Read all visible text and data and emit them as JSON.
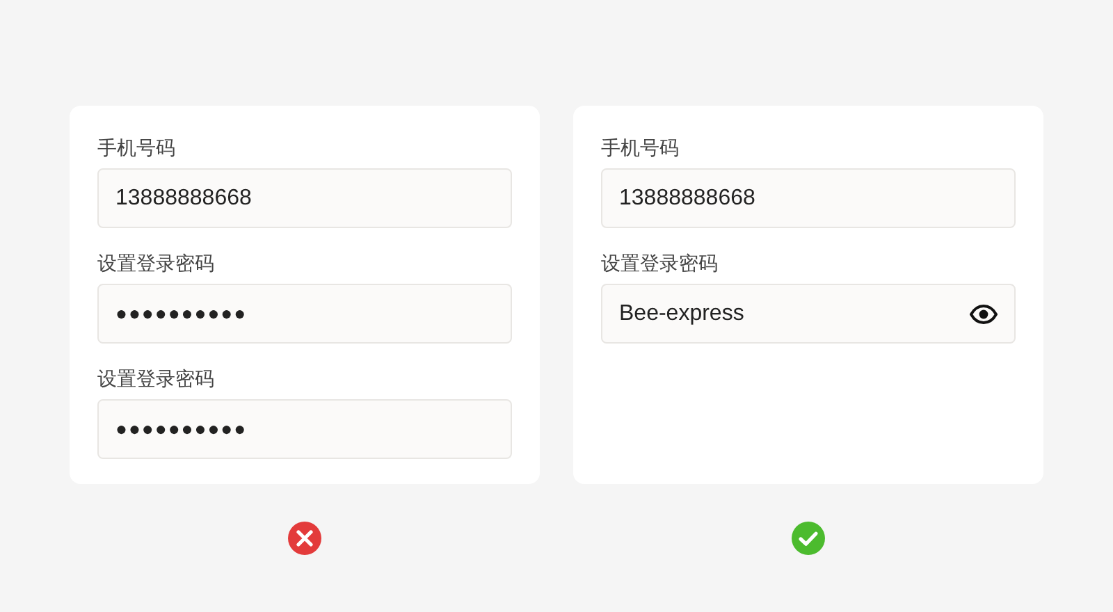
{
  "panels": [
    {
      "kind": "wrong",
      "fields": [
        {
          "label": "手机号码",
          "value": "13888888668",
          "kind": "text"
        },
        {
          "label": "设置登录密码",
          "value": "●●●●●●●●●●",
          "kind": "password"
        },
        {
          "label": "设置登录密码",
          "value": "●●●●●●●●●●",
          "kind": "password"
        }
      ]
    },
    {
      "kind": "right",
      "fields": [
        {
          "label": "手机号码",
          "value": "13888888668",
          "kind": "text"
        },
        {
          "label": "设置登录密码",
          "value": "Bee-express",
          "kind": "revealed"
        }
      ]
    }
  ]
}
